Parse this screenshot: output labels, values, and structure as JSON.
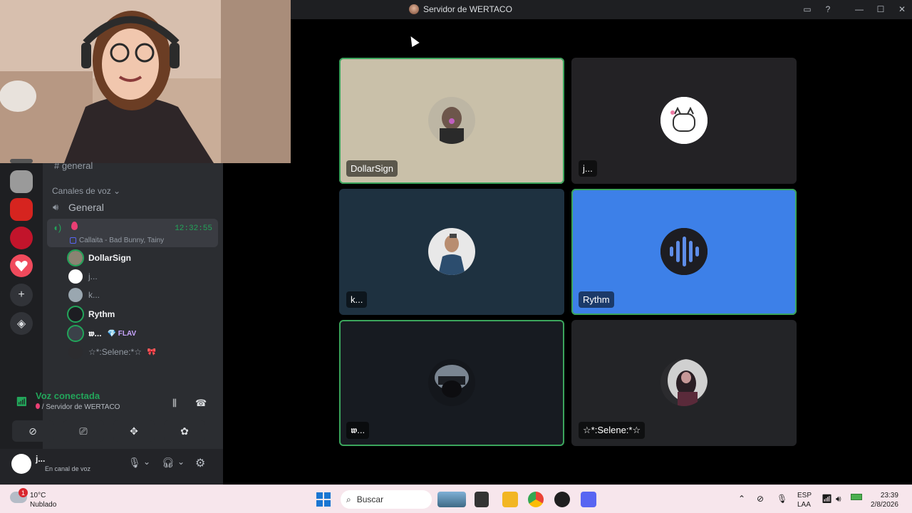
{
  "window": {
    "title": "Servidor de WERTACO"
  },
  "colors": {
    "speaking_green": "#3ba55c",
    "rythm_blue": "#3d80e8",
    "bg_dark": "#1e1f22"
  },
  "sidebar": {
    "text_channel": "general",
    "voice_category": "Canales de voz",
    "voice_channel": "General",
    "active_timer": "12:32:55",
    "activity": "Callaita - Bad Bunny, Tainy",
    "members": [
      {
        "name": "DollarSign"
      },
      {
        "name": "j..."
      },
      {
        "name": "k..."
      },
      {
        "name": "Rythm"
      },
      {
        "name": "𝖜...",
        "badge": "💎 FLAV"
      },
      {
        "name": "☆*:Selene:*☆",
        "badge": "🎀"
      }
    ]
  },
  "voice_panel": {
    "status": "Voz conectada",
    "server": "/ Servidor de WERTACO"
  },
  "user_panel": {
    "name": "j...",
    "status": "En canal de voz"
  },
  "tiles": [
    {
      "name": "DollarSign",
      "speaking": true
    },
    {
      "name": "j...",
      "speaking": false
    },
    {
      "name": "k...",
      "speaking": false
    },
    {
      "name": "Rythm",
      "speaking": true
    },
    {
      "name": "𝖜...",
      "speaking": true
    },
    {
      "name": "☆*:Selene:*☆",
      "speaking": false
    }
  ],
  "taskbar": {
    "temp": "10°C",
    "weather": "Nublado",
    "weather_badge": "1",
    "search_placeholder": "Buscar",
    "lang_top": "ESP",
    "lang_bottom": "LAA",
    "time": "23:39",
    "date": "2/8/2026"
  }
}
